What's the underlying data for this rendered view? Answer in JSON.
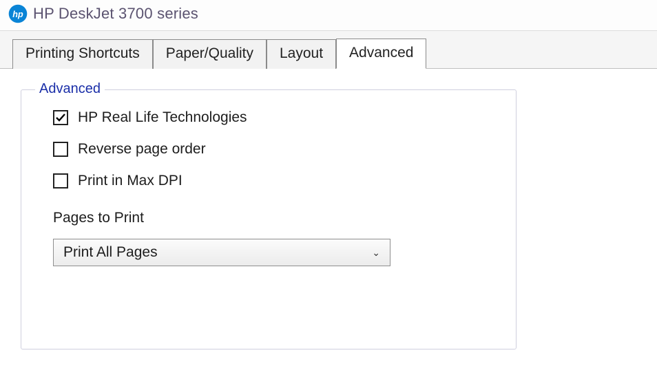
{
  "window": {
    "title": "HP DeskJet 3700 series"
  },
  "tabs": {
    "t0": "Printing Shortcuts",
    "t1": "Paper/Quality",
    "t2": "Layout",
    "t3": "Advanced"
  },
  "group": {
    "legend": "Advanced",
    "check_hp_real_life": "HP Real Life Technologies",
    "check_reverse_order": "Reverse page order",
    "check_max_dpi": "Print in Max DPI",
    "pages_to_print_label": "Pages to Print",
    "pages_to_print_value": "Print All Pages"
  }
}
